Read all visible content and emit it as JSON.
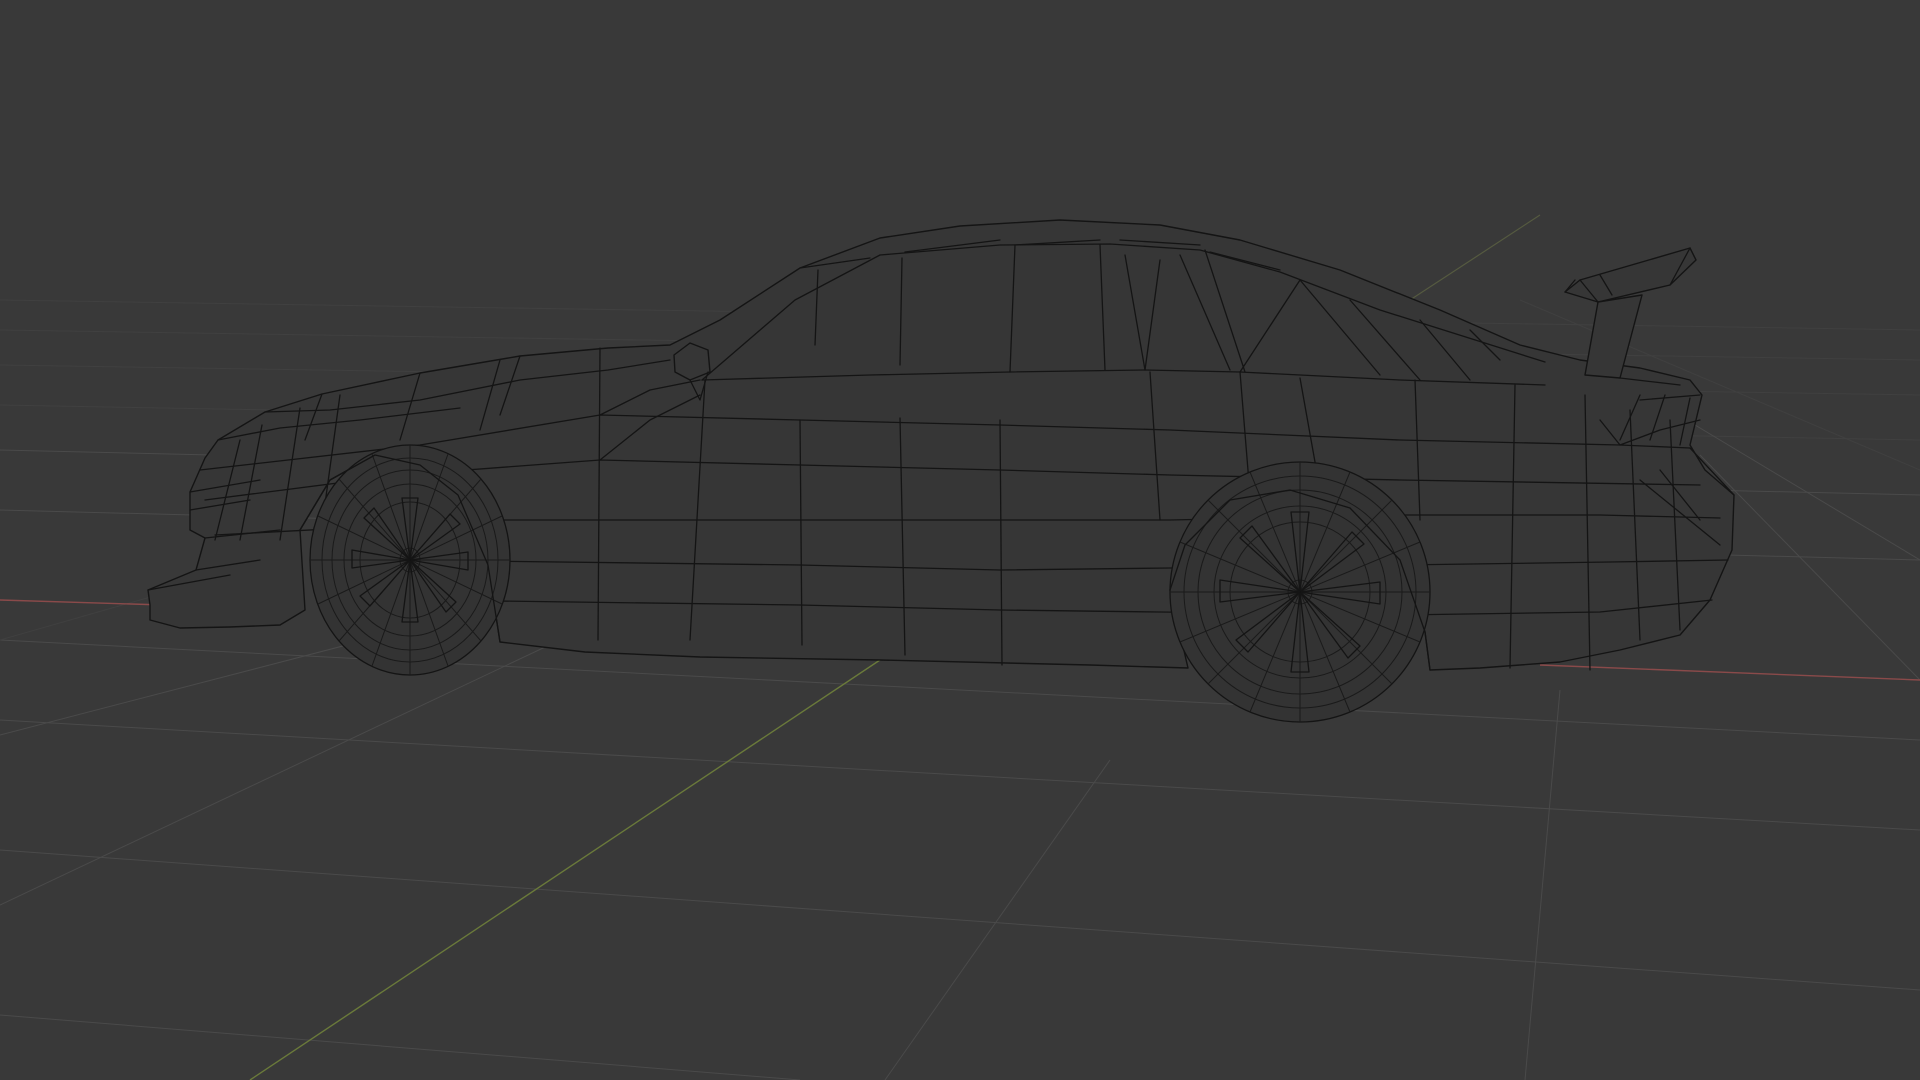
{
  "viewport": {
    "mode": "wireframe",
    "object": "car-mesh",
    "colors": {
      "background": "#393939",
      "grid": "#4a4a4a",
      "x_axis": "#8a4a4a",
      "y_axis": "#6a7a3a",
      "wire": "#141414"
    }
  }
}
